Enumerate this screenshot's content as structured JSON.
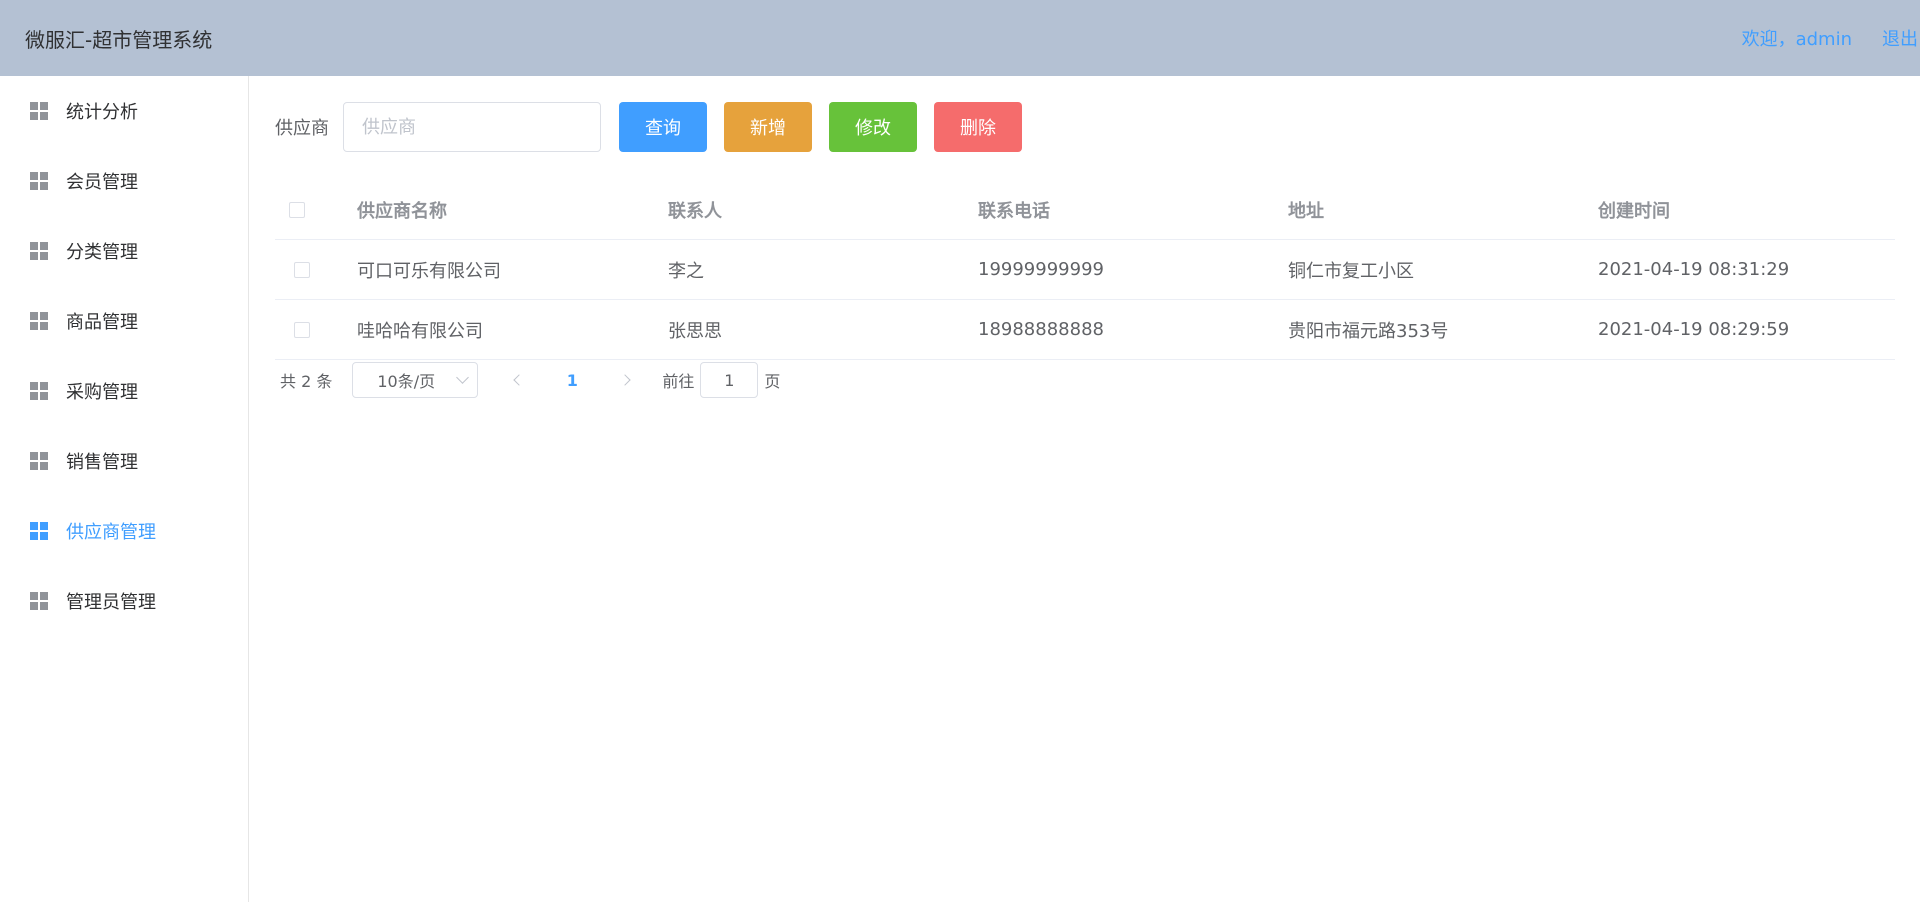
{
  "header": {
    "title": "微服汇-超市管理系统",
    "welcome": "欢迎，admin",
    "logout": "退出"
  },
  "sidebar": {
    "items": [
      {
        "label": "统计分析"
      },
      {
        "label": "会员管理"
      },
      {
        "label": "分类管理"
      },
      {
        "label": "商品管理"
      },
      {
        "label": "采购管理"
      },
      {
        "label": "销售管理"
      },
      {
        "label": "供应商管理",
        "active": true
      },
      {
        "label": "管理员管理"
      }
    ]
  },
  "search": {
    "label": "供应商",
    "placeholder": "供应商",
    "value": ""
  },
  "toolbar": {
    "query": "查询",
    "add": "新增",
    "edit": "修改",
    "delete": "删除"
  },
  "colors": {
    "primary": "#409eff",
    "warning": "#e6a23c",
    "success": "#67c23a",
    "danger": "#f56c6c",
    "header_bg": "#b4c1d3"
  },
  "table": {
    "columns": [
      "供应商名称",
      "联系人",
      "联系电话",
      "地址",
      "创建时间"
    ],
    "rows": [
      [
        "可口可乐有限公司",
        "李之",
        "19999999999",
        "铜仁市复工小区",
        "2021-04-19 08:31:29"
      ],
      [
        "哇哈哈有限公司",
        "张思思",
        "18988888888",
        "贵阳市福元路353号",
        "2021-04-19 08:29:59"
      ]
    ]
  },
  "pagination": {
    "total": "共 2 条",
    "page_size": "10条/页",
    "current_page": "1",
    "goto_prefix": "前往",
    "goto_value": "1",
    "goto_suffix": "页"
  }
}
